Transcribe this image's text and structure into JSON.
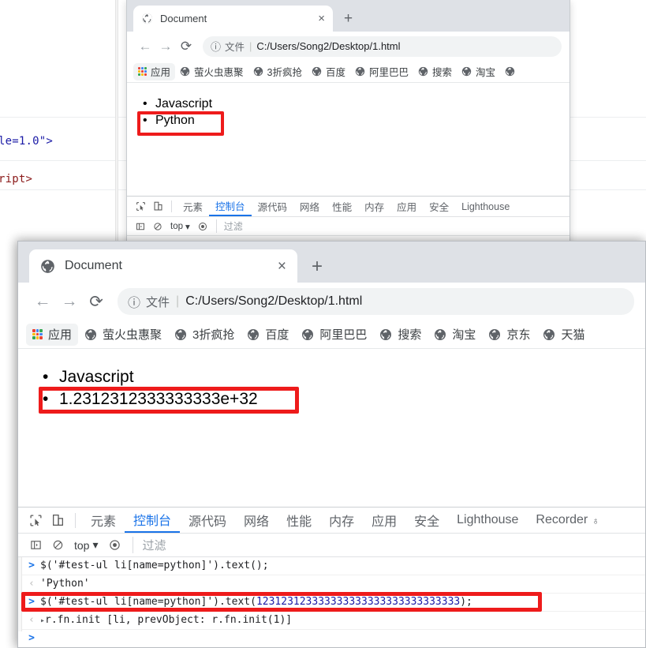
{
  "editor": {
    "line1": "le=1.0\">",
    "line2": "ript>"
  },
  "back_window": {
    "tab": {
      "title": "Document",
      "close": "×",
      "newtab": "+"
    },
    "toolbar": {
      "back": "←",
      "forward": "→",
      "reload": "⟳",
      "info": "ⓘ",
      "scheme": "文件",
      "separator": "|",
      "url": "C:/Users/Song2/Desktop/1.html"
    },
    "bookmarks": [
      {
        "label": "应用",
        "icon": "apps-grid-icon"
      },
      {
        "label": "萤火虫惠聚",
        "icon": "globe-icon"
      },
      {
        "label": "3折疯抢",
        "icon": "globe-icon"
      },
      {
        "label": "百度",
        "icon": "globe-icon"
      },
      {
        "label": "阿里巴巴",
        "icon": "globe-icon"
      },
      {
        "label": "搜索",
        "icon": "globe-icon"
      },
      {
        "label": "淘宝",
        "icon": "globe-icon"
      },
      {
        "label": "",
        "icon": "globe-icon"
      }
    ],
    "page": {
      "item1": "Javascript",
      "item2": "Python"
    },
    "devtools": {
      "tabs": [
        "元素",
        "控制台",
        "源代码",
        "网络",
        "性能",
        "内存",
        "应用",
        "安全",
        "Lighthouse"
      ],
      "active_tab": "控制台",
      "context": "top",
      "context_caret": "▾",
      "filter_placeholder": "过滤"
    }
  },
  "front_window": {
    "tab": {
      "title": "Document",
      "close": "×",
      "newtab": "+"
    },
    "toolbar": {
      "back": "←",
      "forward": "→",
      "reload": "⟳",
      "info": "ⓘ",
      "scheme": "文件",
      "separator": "|",
      "url": "C:/Users/Song2/Desktop/1.html"
    },
    "bookmarks": [
      {
        "label": "应用",
        "icon": "apps-grid-icon"
      },
      {
        "label": "萤火虫惠聚",
        "icon": "globe-icon"
      },
      {
        "label": "3折疯抢",
        "icon": "globe-icon"
      },
      {
        "label": "百度",
        "icon": "globe-icon"
      },
      {
        "label": "阿里巴巴",
        "icon": "globe-icon"
      },
      {
        "label": "搜索",
        "icon": "globe-icon"
      },
      {
        "label": "淘宝",
        "icon": "globe-icon"
      },
      {
        "label": "京东",
        "icon": "globe-icon"
      },
      {
        "label": "天猫",
        "icon": "globe-icon"
      }
    ],
    "page": {
      "item1": "Javascript",
      "item2": "1.2312312333333333e+32"
    },
    "devtools": {
      "tabs": [
        "元素",
        "控制台",
        "源代码",
        "网络",
        "性能",
        "内存",
        "应用",
        "安全",
        "Lighthouse",
        "Recorder"
      ],
      "active_tab": "控制台",
      "recorder_badge": "♁",
      "context": "top",
      "context_caret": "▾",
      "filter_placeholder": "过滤"
    },
    "console": {
      "line1_prompt": ">",
      "line1_code": "$('#test-ul li[name=python]').text();",
      "line2_prompt": "‹",
      "line2_result": "'Python'",
      "line3_prompt": ">",
      "line3_code_before": "$('#test-ul li[name=python]').text(",
      "line3_number": "123123123333333333333333333333333",
      "line3_code_after": ");",
      "line4_prompt": "‹",
      "line4_triangle": "▸",
      "line4_result": "r.fn.init [li, prevObject: r.fn.init(1)]",
      "line5_prompt": ">"
    }
  },
  "annotations": {
    "highlight_color": "#ee1b1b",
    "boxes": [
      "back-python-highlight",
      "front-number-highlight",
      "front-console-command-highlight"
    ]
  }
}
